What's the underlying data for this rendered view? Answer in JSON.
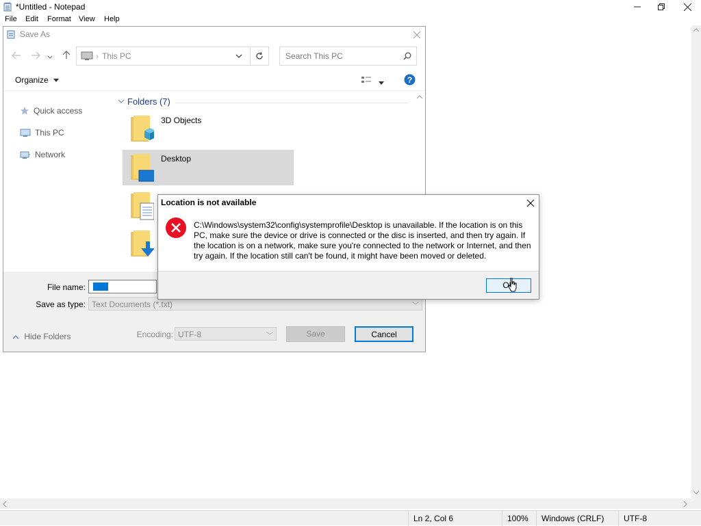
{
  "notepad": {
    "title": "*Untitled - Notepad",
    "menu": [
      "File",
      "Edit",
      "Format",
      "View",
      "Help"
    ],
    "status": {
      "position": "Ln 2, Col 6",
      "zoom": "100%",
      "line_endings": "Windows (CRLF)",
      "encoding": "UTF-8"
    }
  },
  "save_as": {
    "title": "Save As",
    "address": "This PC",
    "search_placeholder": "Search This PC",
    "organize_label": "Organize",
    "nav_pane": [
      "Quick access",
      "This PC",
      "Network"
    ],
    "folders_header": "Folders (7)",
    "folders": [
      "3D Objects",
      "Desktop"
    ],
    "file_name_label": "File name:",
    "save_as_type_label": "Save as type:",
    "save_as_type_value": "Text Documents (*.txt)",
    "encoding_label": "Encoding:",
    "encoding_value": "UTF-8",
    "save_label": "Save",
    "cancel_label": "Cancel",
    "hide_folders_label": "Hide Folders"
  },
  "error_dialog": {
    "title": "Location is not available",
    "message": "C:\\Windows\\system32\\config\\systemprofile\\Desktop is unavailable. If the location is on this PC, make sure the device or drive is connected or the disc is inserted, and then try again. If the location is on a network, make sure you're connected to the network or Internet, and then try again. If the location still can't be found, it might have been moved or deleted.",
    "ok_label": "OK"
  },
  "colors": {
    "accent": "#0078d7",
    "error_red": "#e81123",
    "folder_yellow": "#f8d775",
    "dialog_bg": "#f0f0f0"
  },
  "icons": [
    "notepad-icon",
    "minimize-icon",
    "restore-icon",
    "close-icon",
    "back-arrow-icon",
    "forward-arrow-icon",
    "up-arrow-icon",
    "computer-icon",
    "refresh-icon",
    "search-icon",
    "view-icon",
    "help-icon",
    "star-icon",
    "network-icon",
    "folder-icon",
    "error-icon",
    "cursor-icon"
  ]
}
